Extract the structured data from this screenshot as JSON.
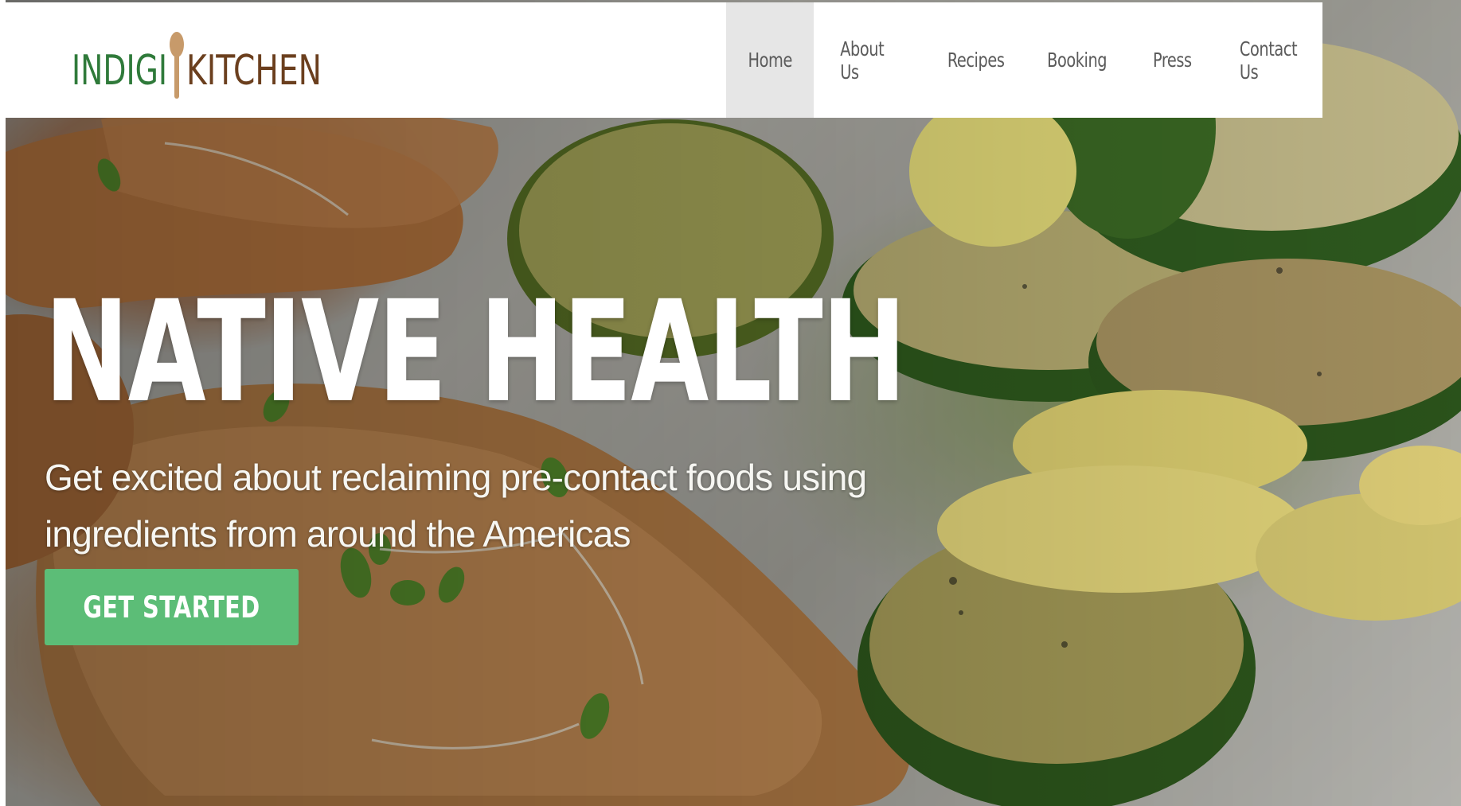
{
  "brand": {
    "logo_text_left": "INDIGI",
    "logo_text_right": "KITCHEN",
    "logo_icon": "wooden-spoon-icon",
    "colors": {
      "logo_green": "#2f7a3a",
      "logo_brown": "#6b3f1e",
      "spoon": "#c79a6a"
    }
  },
  "nav": {
    "items": [
      {
        "label": "Home",
        "active": true
      },
      {
        "label": "About Us",
        "active": false
      },
      {
        "label": "Recipes",
        "active": false
      },
      {
        "label": "Booking",
        "active": false
      },
      {
        "label": "Press",
        "active": false
      },
      {
        "label": "Contact Us",
        "active": false
      }
    ],
    "active_bg": "#e6e6e6",
    "text_color": "#5b5b5b"
  },
  "hero": {
    "title": "NATIVE HEALTH",
    "subtitle": "Get excited about reclaiming pre-contact foods using ingredients from around the Americas",
    "cta_label": "GET STARTED",
    "cta_color": "#5cbd77",
    "background_image": "food-photo"
  }
}
